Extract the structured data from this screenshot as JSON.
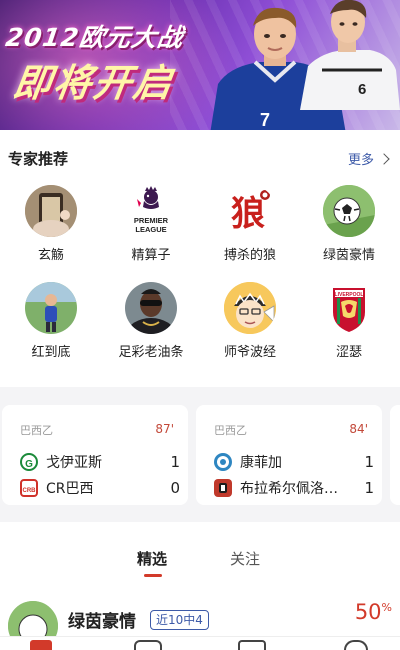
{
  "banner": {
    "line1": "2012欧元大战",
    "line2": "即将开启",
    "jersey_numbers": [
      "7",
      "6"
    ]
  },
  "experts_section": {
    "title": "专家推荐",
    "more_label": "更多",
    "experts": [
      {
        "name": "玄觞"
      },
      {
        "name": "精算子"
      },
      {
        "name": "搏杀的狼"
      },
      {
        "name": "绿茵豪情"
      },
      {
        "name": "红到底"
      },
      {
        "name": "足彩老油条"
      },
      {
        "name": "师爷波经"
      },
      {
        "name": "涩瑟"
      }
    ],
    "logo_texts": {
      "premier_league": "PREMIER LEAGUE",
      "wolf_glyph": "狼",
      "liverpool": "LIVERPOOL"
    }
  },
  "matches": [
    {
      "league": "巴西乙",
      "minute": "87'",
      "home": {
        "name": "戈伊亚斯",
        "score": "1"
      },
      "away": {
        "name": "CR巴西",
        "score": "0"
      }
    },
    {
      "league": "巴西乙",
      "minute": "84'",
      "home": {
        "name": "康菲加",
        "score": "1"
      },
      "away": {
        "name": "布拉希尔佩洛…",
        "score": "1"
      }
    }
  ],
  "tabs": [
    {
      "label": "精选",
      "active": true
    },
    {
      "label": "关注",
      "active": false
    }
  ],
  "recommendation": {
    "name": "绿茵豪情",
    "badge": "近10中4",
    "rate": "50",
    "rate_unit": "%"
  },
  "colors": {
    "accent_red": "#d23a2a",
    "link_blue": "#3d5aa8",
    "banner_purple": "#6a2fb0"
  }
}
